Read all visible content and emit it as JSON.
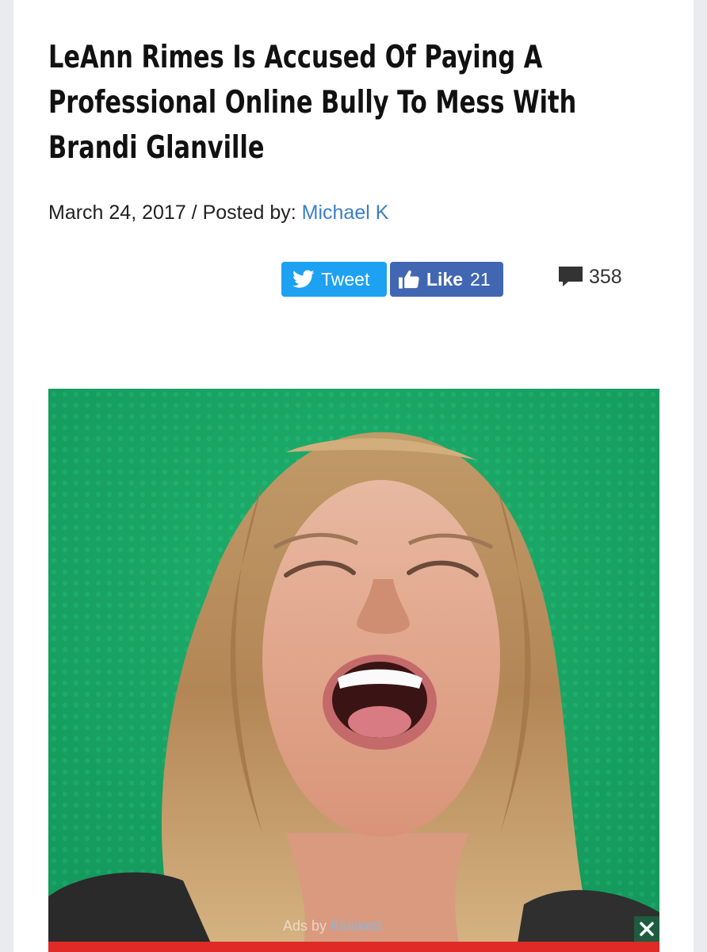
{
  "article": {
    "title_lines": [
      "LeAnn Rimes Is Accused Of Paying A",
      "Professional Online Bully To Mess With",
      "Brandi Glanville"
    ],
    "date": "March 24, 2017",
    "separator": " / ",
    "posted_by_label": "Posted by: ",
    "author": "Michael K"
  },
  "social": {
    "tweet_label": "Tweet",
    "like_label": "Like",
    "like_count": "21",
    "comment_count": "358",
    "icons": [
      "twitter-bird-icon",
      "thumbs-up-icon",
      "comment-bubble-icon"
    ]
  },
  "ad": {
    "label_prefix": "Ads by ",
    "brand": "Kiosked",
    "close_icon": "close-icon"
  },
  "colors": {
    "twitter_blue": "#1da1f2",
    "facebook_blue": "#4267b2",
    "author_link": "#3b7fc4",
    "ad_red": "#e02a26",
    "photo_background_green": "#1aa865"
  }
}
